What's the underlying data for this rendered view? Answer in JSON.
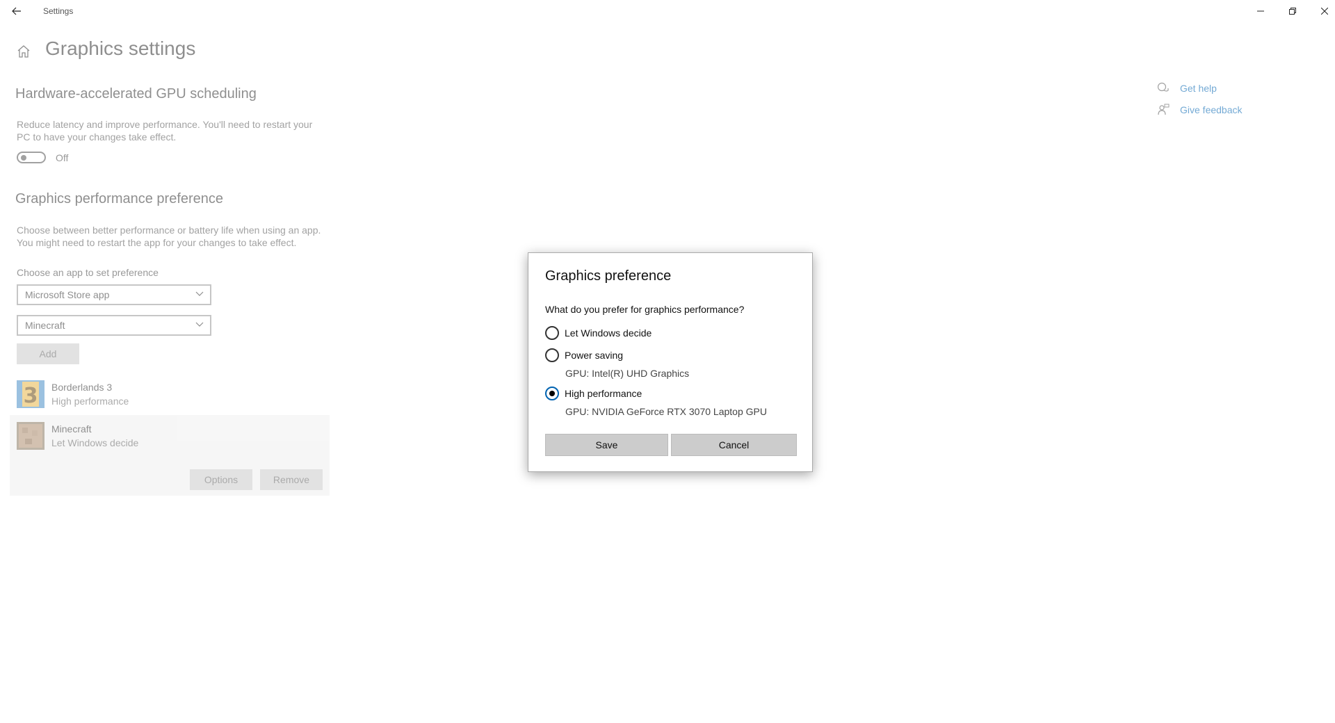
{
  "window": {
    "title": "Settings"
  },
  "page": {
    "title": "Graphics settings",
    "gpu_scheduling": {
      "heading": "Hardware-accelerated GPU scheduling",
      "desc_line1": "Reduce latency and improve performance. You'll need to restart your",
      "desc_line2": "PC to have your changes take effect.",
      "toggle_state": "Off"
    },
    "preference": {
      "heading": "Graphics performance preference",
      "desc_line1": "Choose between better performance or battery life when using an app.",
      "desc_line2": "You might need to restart the app for your changes to take effect.",
      "choose_label": "Choose an app to set preference",
      "app_type_select": "Microsoft Store app",
      "app_select": "Minecraft",
      "add_label": "Add"
    },
    "apps": [
      {
        "name": "Borderlands 3",
        "pref": "High performance"
      },
      {
        "name": "Minecraft",
        "pref": "Let Windows decide"
      }
    ],
    "options_label": "Options",
    "remove_label": "Remove"
  },
  "side_links": {
    "get_help": "Get help",
    "give_feedback": "Give feedback"
  },
  "dialog": {
    "title": "Graphics preference",
    "question": "What do you prefer for graphics performance?",
    "options": [
      {
        "label": "Let Windows decide",
        "gpu": "",
        "checked": false
      },
      {
        "label": "Power saving",
        "gpu": "GPU: Intel(R) UHD Graphics",
        "checked": false
      },
      {
        "label": "High performance",
        "gpu": "GPU: NVIDIA GeForce RTX 3070 Laptop GPU",
        "checked": true
      }
    ],
    "save_label": "Save",
    "cancel_label": "Cancel"
  },
  "colors": {
    "accent": "#0063b1"
  }
}
